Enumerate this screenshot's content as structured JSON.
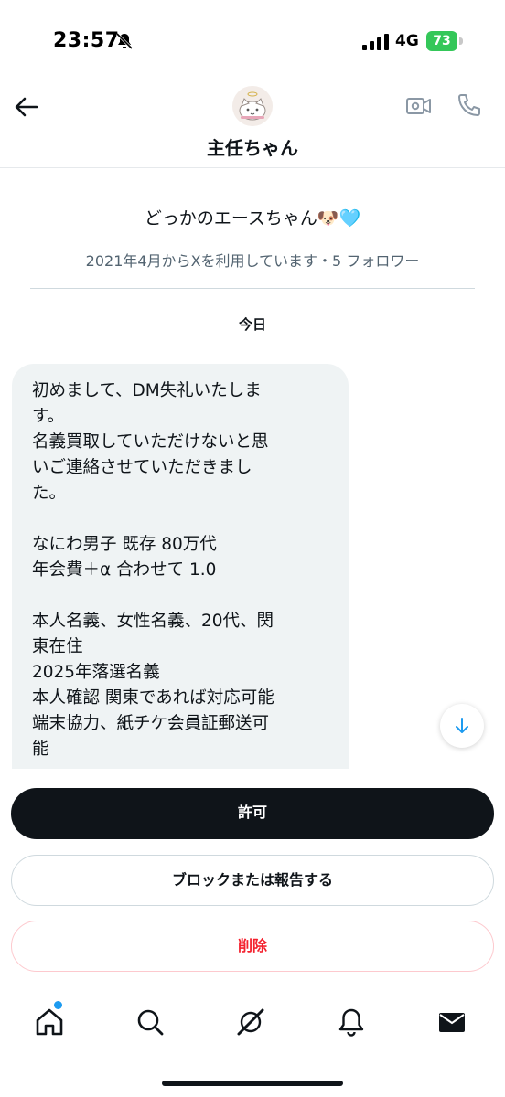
{
  "status_bar": {
    "time": "23:57",
    "network": "4G",
    "battery": "73"
  },
  "header": {
    "title": "主任ちゃん"
  },
  "profile": {
    "display_name": "どっかのエースちゃん🐶🩵",
    "meta": "2021年4月からXを利用しています・5 フォロワー"
  },
  "conversation": {
    "date_label": "今日",
    "message_lines": [
      "初めまして、DM失礼いたしま",
      "す。",
      "名義買取していただけないと思",
      "いご連絡させていただきまし",
      "た。",
      "",
      "なにわ男子 既存 80万代",
      "年会費＋α 合わせて 1.0",
      "",
      "本人名義、女性名義、20代、関",
      "東在住",
      "2025年落選名義",
      "本人確認 関東であれば対応可能",
      "端末協力、紙チケ会員証郵送可",
      "能"
    ]
  },
  "actions": {
    "allow_label": "許可",
    "block_label": "ブロックまたは報告する",
    "delete_label": "削除"
  },
  "nav": {
    "items": [
      "home-icon",
      "search-icon",
      "grok-icon",
      "bell-icon",
      "mail-icon"
    ],
    "notification_dot_color": "#1d9bf0"
  },
  "colors": {
    "accent": "#1d9bf0",
    "danger": "#f4212e",
    "bubble": "#eff3f4",
    "battery": "#34c759"
  }
}
